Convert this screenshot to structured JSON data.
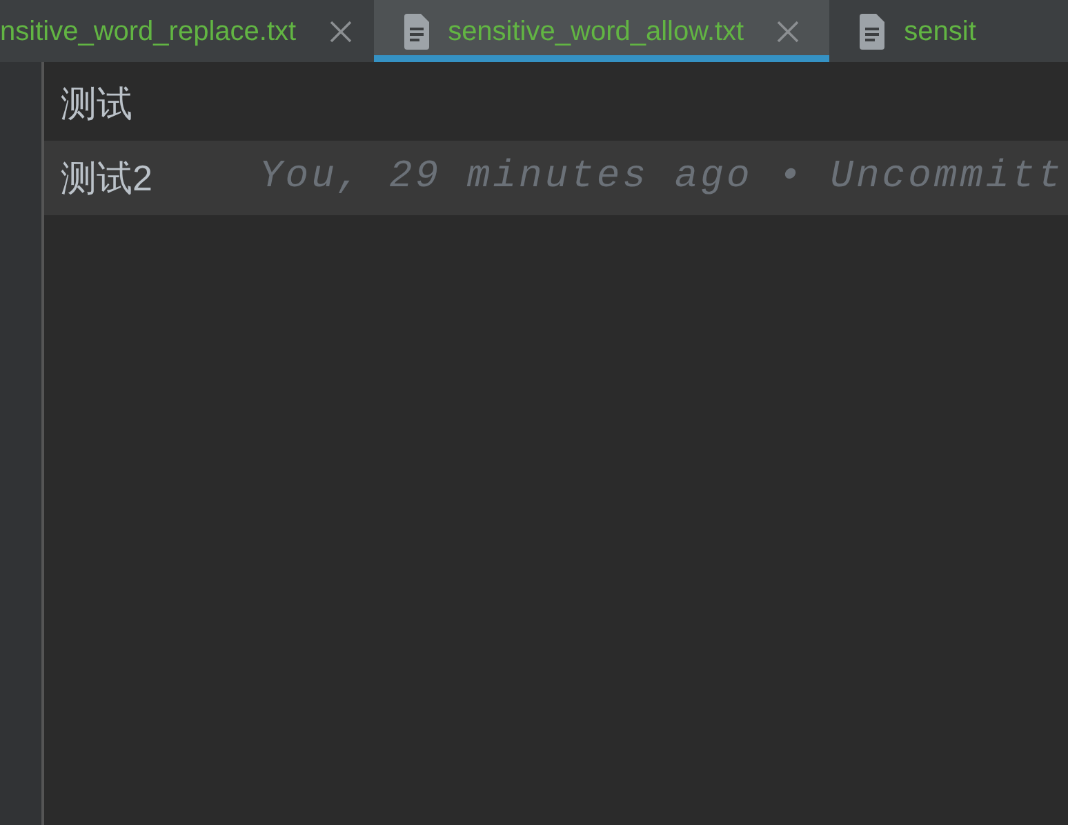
{
  "tabs": [
    {
      "label": "nsitive_word_replace.txt",
      "selected": false,
      "file_icon": false,
      "close": true
    },
    {
      "label": "sensitive_word_allow.txt",
      "selected": true,
      "file_icon": true,
      "close": true
    },
    {
      "label": "sensit",
      "selected": false,
      "file_icon": true,
      "close": false
    }
  ],
  "lines": [
    {
      "text": "测试",
      "current": false
    },
    {
      "text": "测试2",
      "current": true,
      "blame": "You, 29 minutes ago • Uncommitt"
    }
  ]
}
